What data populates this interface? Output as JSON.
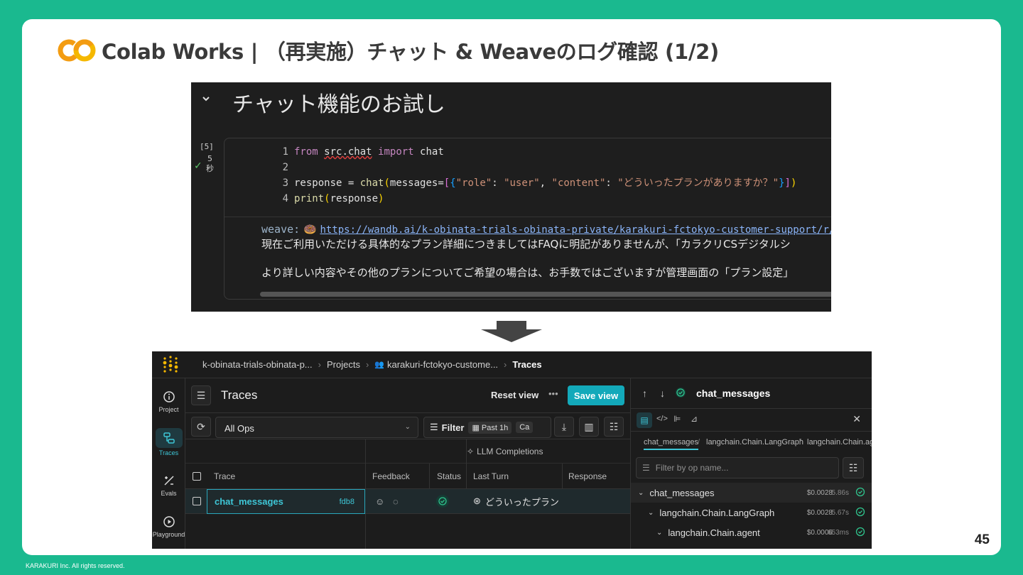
{
  "slide": {
    "title": "Colab Works | （再実施）チャット & Weaveのログ確認 (1/2)",
    "page_number": "45",
    "copyright": "KARAKURI Inc. All rights reserved.",
    "logo_text": "CO"
  },
  "colab": {
    "section_title": "チャット機能のお試し",
    "exec_count": "[5]",
    "exec_time": "5",
    "exec_unit": "秒",
    "code_lines": [
      "1",
      "2",
      "3",
      "4"
    ],
    "code": {
      "l1_kw1": "from",
      "l1_mod": "src.chat",
      "l1_kw2": "import",
      "l1_name": "chat",
      "l3_var": "response",
      "l3_eq": " = ",
      "l3_fn": "chat",
      "l3_arg": "messages",
      "l3_k1": "\"role\"",
      "l3_v1": "\"user\"",
      "l3_k2": "\"content\"",
      "l3_v2": "\"どういったプランがありますか？\"",
      "l4_fn": "print",
      "l4_arg": "response"
    },
    "output": {
      "label": "weave:",
      "link": "https://wandb.ai/k-obinata-trials-obinata-private/karakuri-fctokyo-customer-support/r/cal",
      "line2": "現在ご利用いただける具体的なプラン詳細につきましてはFAQに明記がありませんが、「カラクリCSデジタルシ",
      "line3": "より詳しい内容やその他のプランについてご希望の場合は、お手数ではございますが管理画面の「プラン設定」"
    }
  },
  "weave": {
    "breadcrumb": [
      "k-obinata-trials-obinata-p...",
      "Projects",
      "karakuri-fctokyo-custome...",
      "Traces"
    ],
    "rail": [
      {
        "label": "Project",
        "icon": "info-icon"
      },
      {
        "label": "Traces",
        "icon": "traces-icon"
      },
      {
        "label": "Evals",
        "icon": "evals-icon"
      },
      {
        "label": "Playground",
        "icon": "play-icon"
      }
    ],
    "page_title": "Traces",
    "reset_view": "Reset view",
    "more": "•••",
    "save_view": "Save view",
    "ops_select": "All Ops",
    "filter_label": "Filter",
    "filter_chip1": "Past 1h",
    "filter_chip2": "Ca",
    "group_header": "LLM Completions",
    "columns": {
      "trace": "Trace",
      "feedback": "Feedback",
      "status": "Status",
      "last_turn": "Last Turn",
      "response": "Response"
    },
    "row": {
      "trace": "chat_messages",
      "hash": "fdb8",
      "last_turn": "どういったプラン"
    },
    "detail": {
      "title": "chat_messages",
      "tabs": [
        "chat_messages",
        "langchain.Chain.LangGraph",
        "langchain.Chain.ag"
      ],
      "filter_placeholder": "Filter by op name...",
      "tree": [
        {
          "name": "chat_messages",
          "cost": "$0.0028",
          "duration": "5.86s"
        },
        {
          "name": "langchain.Chain.LangGraph",
          "cost": "$0.0028",
          "duration": "5.67s"
        },
        {
          "name": "langchain.Chain.agent",
          "cost": "$0.0006",
          "duration": "653ms"
        }
      ]
    }
  },
  "colors": {
    "background": "#1ab98f",
    "accent": "#13a9ba",
    "logo_orange": "#f39c12",
    "logo_yellow": "#f5b800"
  }
}
